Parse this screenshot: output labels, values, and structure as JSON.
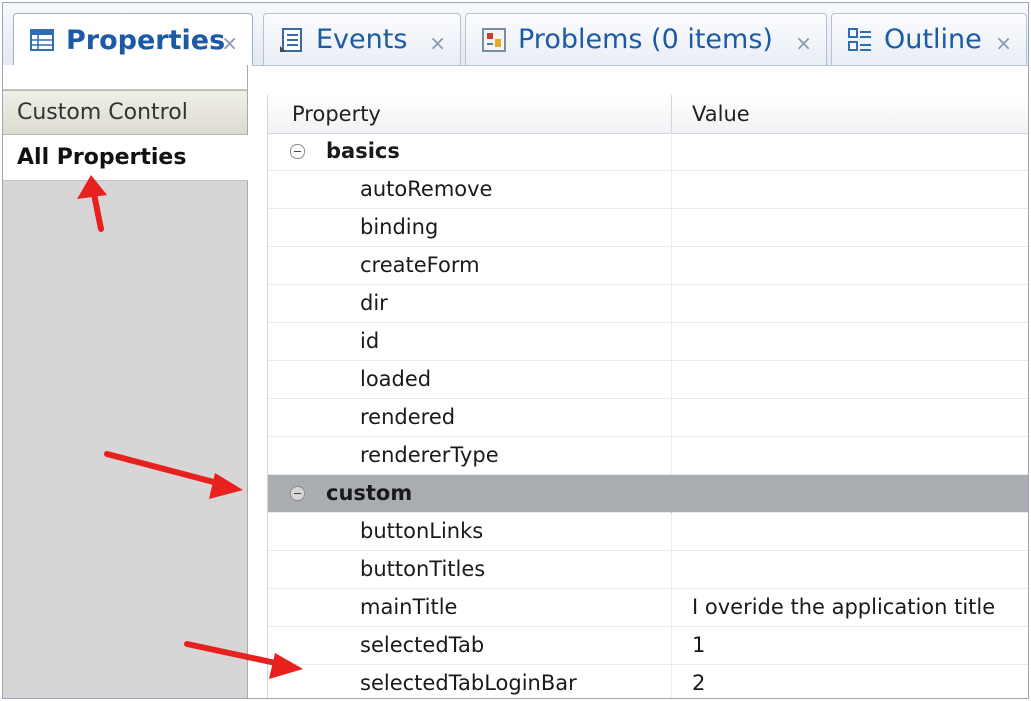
{
  "tabs": [
    {
      "label": "Properties",
      "icon": "properties-icon",
      "close": "×",
      "active": true
    },
    {
      "label": "Events",
      "icon": "events-icon",
      "close": "×",
      "active": false
    },
    {
      "label": "Problems (0 items)",
      "icon": "problems-icon",
      "close": "×",
      "active": false
    },
    {
      "label": "Outline",
      "icon": "outline-icon",
      "close": "×",
      "active": false
    }
  ],
  "sidebar": {
    "items": [
      {
        "label": "Custom Control"
      },
      {
        "label": "All Properties",
        "selected": true
      }
    ]
  },
  "table": {
    "headers": {
      "property": "Property",
      "value": "Value"
    },
    "rows": [
      {
        "kind": "category",
        "property": "basics",
        "value": ""
      },
      {
        "kind": "property",
        "property": "autoRemove",
        "value": ""
      },
      {
        "kind": "property",
        "property": "binding",
        "value": ""
      },
      {
        "kind": "property",
        "property": "createForm",
        "value": ""
      },
      {
        "kind": "property",
        "property": "dir",
        "value": ""
      },
      {
        "kind": "property",
        "property": "id",
        "value": ""
      },
      {
        "kind": "property",
        "property": "loaded",
        "value": ""
      },
      {
        "kind": "property",
        "property": "rendered",
        "value": ""
      },
      {
        "kind": "property",
        "property": "rendererType",
        "value": ""
      },
      {
        "kind": "category",
        "property": "custom",
        "value": "",
        "selected": true
      },
      {
        "kind": "property",
        "property": "buttonLinks",
        "value": ""
      },
      {
        "kind": "property",
        "property": "buttonTitles",
        "value": ""
      },
      {
        "kind": "property",
        "property": "mainTitle",
        "value": "I overide the application title"
      },
      {
        "kind": "property",
        "property": "selectedTab",
        "value": "1"
      },
      {
        "kind": "property",
        "property": "selectedTabLoginBar",
        "value": "2"
      }
    ]
  },
  "colors": {
    "tab_text": "#1c5aa6",
    "selected_row": "#a9acb0",
    "sidebar_bg": "#d7d5d5",
    "annotation_arrow": "#e8201e"
  }
}
